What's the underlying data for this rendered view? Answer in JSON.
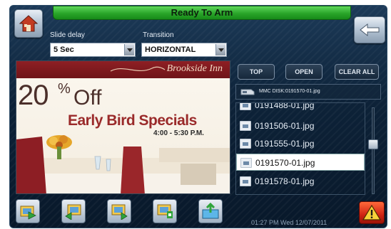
{
  "status": {
    "text": "Ready To Arm"
  },
  "settings": {
    "slide_delay": {
      "label": "Slide delay",
      "value": "5 Sec"
    },
    "transition": {
      "label": "Transition",
      "value": "HORIZONTAL"
    }
  },
  "actions": {
    "top": "TOP",
    "open": "OPEN",
    "clear_all": "CLEAR ALL"
  },
  "disk_path": "MMC DISK:0191570-01.jpg",
  "files": [
    {
      "name": "0191488-01.jpg",
      "selected": false
    },
    {
      "name": "0191506-01.jpg",
      "selected": false
    },
    {
      "name": "0191555-01.jpg",
      "selected": false
    },
    {
      "name": "0191570-01.jpg",
      "selected": true
    },
    {
      "name": "0191578-01.jpg",
      "selected": false
    }
  ],
  "preview": {
    "brand": "Brookside Inn",
    "percent": "20",
    "percent_sign": "%",
    "off": "Off",
    "headline": "Early Bird Specials",
    "hours": "4:00 - 5:30 P.M."
  },
  "clock": "01:27 PM  Wed 12/07/2011",
  "icons": {
    "home": "home-icon",
    "back": "back-arrow-icon",
    "alarm": "warning-icon"
  },
  "colors": {
    "status_green": "#2aa52a",
    "alarm_red": "#d02414",
    "panel": "#0d2238"
  }
}
